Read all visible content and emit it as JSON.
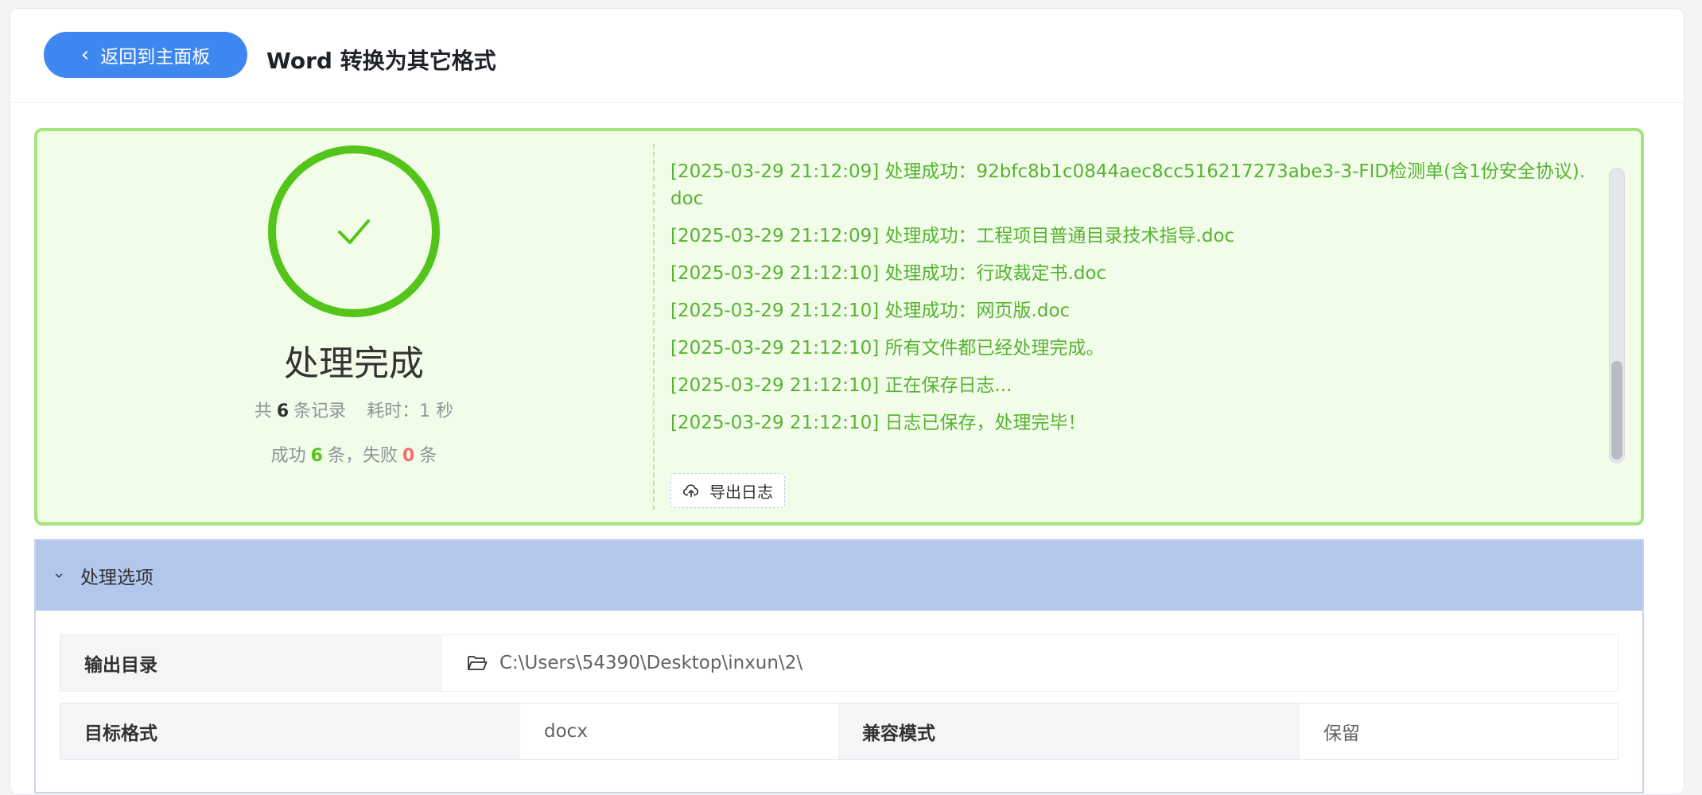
{
  "header": {
    "back_label": "返回到主面板",
    "title": "Word 转换为其它格式"
  },
  "result": {
    "status_title": "处理完成",
    "total_prefix": "共",
    "total_count": "6",
    "total_suffix": "条记录",
    "time_label": "耗时：",
    "time_value": "1 秒",
    "success_prefix": "成功",
    "success_count": "6",
    "success_suffix": "条，失败",
    "fail_count": "0",
    "fail_suffix": "条",
    "status_color": "#52c41a"
  },
  "log": {
    "lines": [
      "[2025-03-29 21:12:09] 处理成功：92bfc8b1c0844aec8cc516217273abe3-3-FID检测单(含1份安全协议).doc",
      "[2025-03-29 21:12:09] 处理成功：工程项目普通目录技术指导.doc",
      "[2025-03-29 21:12:10] 处理成功：行政裁定书.doc",
      "[2025-03-29 21:12:10] 处理成功：网页版.doc",
      "[2025-03-29 21:12:10] 所有文件都已经处理完成。",
      "[2025-03-29 21:12:10] 正在保存日志...",
      "[2025-03-29 21:12:10] 日志已保存，处理完毕！"
    ],
    "export_label": "导出日志"
  },
  "options": {
    "section_title": "处理选项",
    "output_dir_label": "输出目录",
    "output_dir_value": "C:\\Users\\54390\\Desktop\\inxun\\2\\",
    "target_format_label": "目标格式",
    "target_format_value": "docx",
    "compat_mode_label": "兼容模式",
    "compat_mode_value": "保留"
  }
}
